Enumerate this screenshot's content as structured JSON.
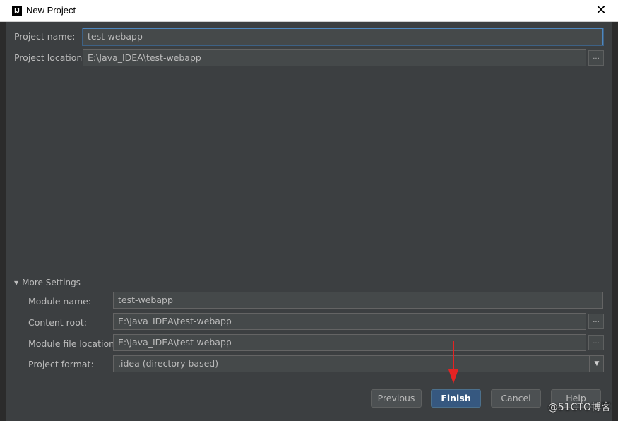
{
  "window": {
    "title": "New Project",
    "app_icon_text": "IJ",
    "close_symbol": "✕"
  },
  "project": {
    "name_label": "Project name:",
    "name_value": "test-webapp",
    "location_label": "Project location:",
    "location_value": "E:\\Java_IDEA\\test-webapp",
    "browse_label": "..."
  },
  "more_settings": {
    "header": "More Settings",
    "expanded": true,
    "module_name_label": "Module name:",
    "module_name_value": "test-webapp",
    "content_root_label": "Content root:",
    "content_root_value": "E:\\Java_IDEA\\test-webapp",
    "module_file_label": "Module file location:",
    "module_file_value": "E:\\Java_IDEA\\test-webapp",
    "project_format_label": "Project format:",
    "project_format_value": ".idea (directory based)",
    "browse_label": "..."
  },
  "buttons": {
    "previous": "Previous",
    "finish": "Finish",
    "cancel": "Cancel",
    "help": "Help"
  },
  "annotation": {
    "arrow_color": "#e52323"
  },
  "watermark": "@51CTO博客",
  "colors": {
    "background": "#3c3f41",
    "field_bg": "#45494a",
    "primary_button": "#365880",
    "focus_border": "#4f87bf"
  }
}
